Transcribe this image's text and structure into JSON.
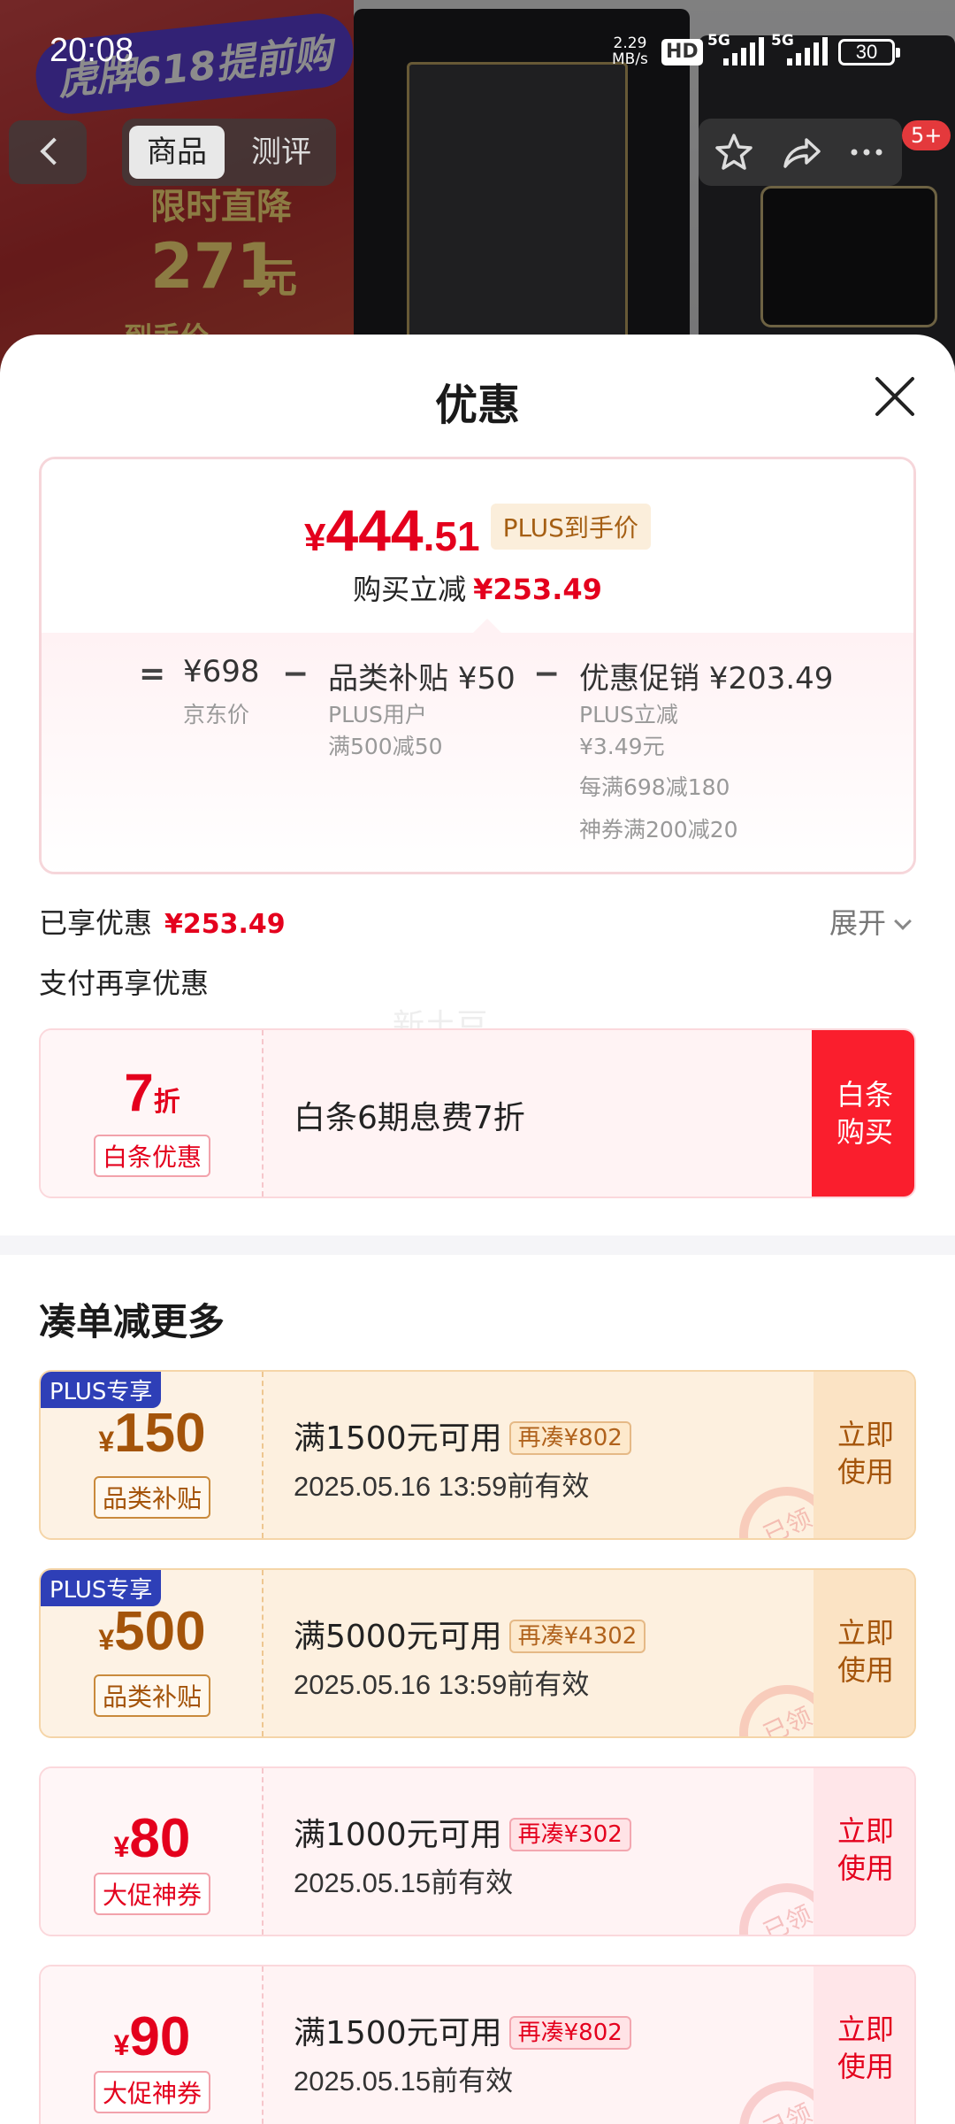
{
  "status_bar": {
    "time": "20:08",
    "net_speed_value": "2.29",
    "net_speed_unit": "MB/s",
    "hd": "HD",
    "signal1": "5G",
    "signal2": "5G",
    "battery": "30"
  },
  "background": {
    "promo_badge": "虎牌618提前购",
    "promo_line1": "限时直降",
    "promo_amount": "271",
    "promo_unit": "元",
    "promo_sub": "到手价"
  },
  "nav": {
    "tabs": [
      {
        "label": "商品",
        "active": true
      },
      {
        "label": "测评",
        "active": false
      }
    ],
    "badge": "5+",
    "icons": [
      "back-icon",
      "star-icon",
      "share-icon",
      "more-icon"
    ]
  },
  "sheet": {
    "title": "优惠",
    "summary": {
      "currency": "¥",
      "price_int": "444",
      "price_dec": ".51",
      "plus_tag": "PLUS到手价",
      "reduce_label": "购买立减",
      "reduce_value": "¥253.49",
      "breakdown": {
        "eq": "=",
        "jd_price": "¥698",
        "jd_price_label": "京东价",
        "minus": "−",
        "subsidy": "品类补贴 ¥50",
        "subsidy_line1": "PLUS用户",
        "subsidy_line2": "满500减50",
        "promo": "优惠促销 ¥203.49",
        "promo_line1": "PLUS立减",
        "promo_line2": "¥3.49元",
        "promo_line3": "每满698减180",
        "promo_line4": "神券满200减20"
      }
    },
    "enjoyed_label": "已享优惠",
    "enjoyed_value": "¥253.49",
    "expand_label": "展开",
    "pay_more_label": "支付再享优惠",
    "watermark": "新土豆",
    "baitiao": {
      "value": "7",
      "unit": "折",
      "tag": "白条优惠",
      "desc": "白条6期息费7折",
      "button_line1": "白条",
      "button_line2": "购买"
    },
    "section_title": "凑单减更多",
    "coupons": [
      {
        "style": "gold",
        "plus": "PLUS专享",
        "currency": "¥",
        "value": "150",
        "tag": "品类补贴",
        "condition": "满1500元可用",
        "more": "再凑¥802",
        "date": "2025.05.16 13:59前有效",
        "btn1": "立即",
        "btn2": "使用",
        "stamp": "已领"
      },
      {
        "style": "gold",
        "plus": "PLUS专享",
        "currency": "¥",
        "value": "500",
        "tag": "品类补贴",
        "condition": "满5000元可用",
        "more": "再凑¥4302",
        "date": "2025.05.16 13:59前有效",
        "btn1": "立即",
        "btn2": "使用",
        "stamp": "已领"
      },
      {
        "style": "red",
        "plus": "",
        "currency": "¥",
        "value": "80",
        "tag": "大促神券",
        "condition": "满1000元可用",
        "more": "再凑¥302",
        "date": "2025.05.15前有效",
        "btn1": "立即",
        "btn2": "使用",
        "stamp": "已领"
      },
      {
        "style": "red",
        "plus": "",
        "currency": "¥",
        "value": "90",
        "tag": "大促神券",
        "condition": "满1500元可用",
        "more": "再凑¥802",
        "date": "2025.05.15前有效",
        "btn1": "立即",
        "btn2": "使用",
        "stamp": "已领"
      }
    ],
    "colors": {
      "accent_red": "#e4001d",
      "baitiao_button": "#fa1e2d",
      "gold_text": "#a4540a",
      "plus_blue": "#2e3fb7"
    }
  }
}
